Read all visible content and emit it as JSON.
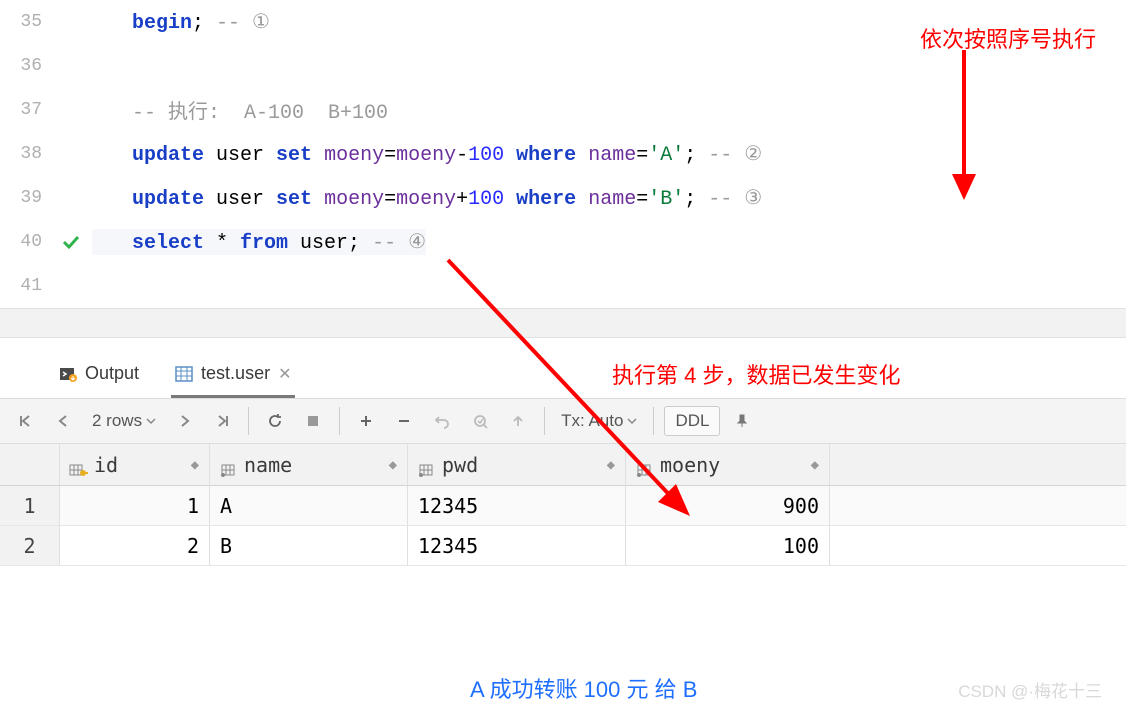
{
  "editor": {
    "lines": [
      {
        "num": "35",
        "tokens": [
          {
            "t": "begin",
            "c": "kw"
          },
          {
            "t": "; ",
            "c": ""
          },
          {
            "t": "-- ①",
            "c": "comment"
          }
        ]
      },
      {
        "num": "36",
        "tokens": []
      },
      {
        "num": "37",
        "tokens": [
          {
            "t": "-- 执行:  A-100  B+100",
            "c": "comment"
          }
        ]
      },
      {
        "num": "38",
        "tokens": [
          {
            "t": "update",
            "c": "kw"
          },
          {
            "t": " user ",
            "c": ""
          },
          {
            "t": "set",
            "c": "kw"
          },
          {
            "t": " ",
            "c": ""
          },
          {
            "t": "moeny",
            "c": "ident"
          },
          {
            "t": "=",
            "c": ""
          },
          {
            "t": "moeny",
            "c": "ident"
          },
          {
            "t": "-",
            "c": ""
          },
          {
            "t": "100",
            "c": "num"
          },
          {
            "t": " ",
            "c": ""
          },
          {
            "t": "where",
            "c": "kw"
          },
          {
            "t": " ",
            "c": ""
          },
          {
            "t": "name",
            "c": "ident"
          },
          {
            "t": "=",
            "c": ""
          },
          {
            "t": "'A'",
            "c": "str"
          },
          {
            "t": "; ",
            "c": ""
          },
          {
            "t": "-- ②",
            "c": "comment"
          }
        ]
      },
      {
        "num": "39",
        "tokens": [
          {
            "t": "update",
            "c": "kw"
          },
          {
            "t": " user ",
            "c": ""
          },
          {
            "t": "set",
            "c": "kw"
          },
          {
            "t": " ",
            "c": ""
          },
          {
            "t": "moeny",
            "c": "ident"
          },
          {
            "t": "=",
            "c": ""
          },
          {
            "t": "moeny",
            "c": "ident"
          },
          {
            "t": "+",
            "c": ""
          },
          {
            "t": "100",
            "c": "num"
          },
          {
            "t": " ",
            "c": ""
          },
          {
            "t": "where",
            "c": "kw"
          },
          {
            "t": " ",
            "c": ""
          },
          {
            "t": "name",
            "c": "ident"
          },
          {
            "t": "=",
            "c": ""
          },
          {
            "t": "'B'",
            "c": "str"
          },
          {
            "t": "; ",
            "c": ""
          },
          {
            "t": "-- ③",
            "c": "comment"
          }
        ]
      },
      {
        "num": "40",
        "tokens": [
          {
            "t": "select",
            "c": "kw"
          },
          {
            "t": " * ",
            "c": ""
          },
          {
            "t": "from",
            "c": "kw"
          },
          {
            "t": " user; ",
            "c": ""
          },
          {
            "t": "-- ④",
            "c": "comment"
          }
        ],
        "check": true
      },
      {
        "num": "41",
        "tokens": []
      }
    ]
  },
  "tabs": {
    "output": "Output",
    "result": "test.user"
  },
  "toolbar": {
    "rows": "2 rows",
    "tx": "Tx: Auto",
    "ddl": "DDL"
  },
  "grid": {
    "columns": [
      {
        "key": "id",
        "label": "id",
        "icon": "key"
      },
      {
        "key": "name",
        "label": "name",
        "icon": "col"
      },
      {
        "key": "pwd",
        "label": "pwd",
        "icon": "col"
      },
      {
        "key": "moeny",
        "label": "moeny",
        "icon": "col"
      }
    ],
    "rows": [
      {
        "n": "1",
        "id": "1",
        "name": "A",
        "pwd": "12345",
        "moeny": "900"
      },
      {
        "n": "2",
        "id": "2",
        "name": "B",
        "pwd": "12345",
        "moeny": "100"
      }
    ]
  },
  "annotations": {
    "top_right": "依次按照序号执行",
    "middle": "执行第 4 步，数据已发生变化",
    "bottom_blue": "A 成功转账 100 元 给 B",
    "watermark": "CSDN @·梅花十三"
  }
}
